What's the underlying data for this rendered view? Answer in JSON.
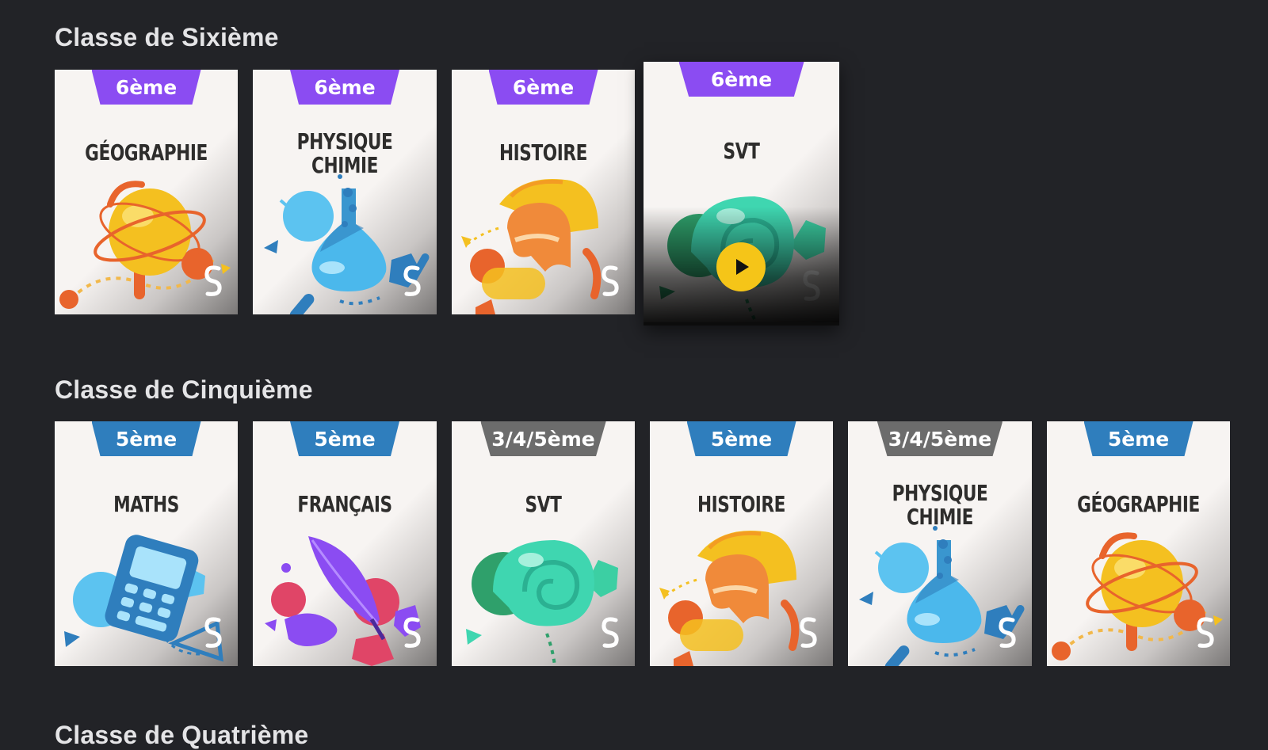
{
  "sections": [
    {
      "title": "Classe de Sixième",
      "cards": [
        {
          "badge": "6ème",
          "badge_color": "#8b4cf2",
          "title": "GÉOGRAPHIE",
          "illustration": "globe-icon"
        },
        {
          "badge": "6ème",
          "badge_color": "#8b4cf2",
          "title": "PHYSIQUE\nCHIMIE",
          "illustration": "flask-icon"
        },
        {
          "badge": "6ème",
          "badge_color": "#8b4cf2",
          "title": "HISTOIRE",
          "illustration": "helmet-icon"
        },
        {
          "badge": "6ème",
          "badge_color": "#8b4cf2",
          "title": "SVT",
          "illustration": "shell-icon",
          "state": "hover-with-play"
        }
      ]
    },
    {
      "title": "Classe de Cinquième",
      "cards": [
        {
          "badge": "5ème",
          "badge_color": "#2f7ebd",
          "title": "MATHS",
          "illustration": "calculator-icon"
        },
        {
          "badge": "5ème",
          "badge_color": "#2f7ebd",
          "title": "FRANÇAIS",
          "illustration": "feather-icon"
        },
        {
          "badge": "3/4/5ème",
          "badge_color": "#6c6c6c",
          "title": "SVT",
          "illustration": "shell-icon"
        },
        {
          "badge": "5ème",
          "badge_color": "#2f7ebd",
          "title": "HISTOIRE",
          "illustration": "helmet-icon"
        },
        {
          "badge": "3/4/5ème",
          "badge_color": "#6c6c6c",
          "title": "PHYSIQUE\nCHIMIE",
          "illustration": "flask-icon"
        },
        {
          "badge": "5ème",
          "badge_color": "#2f7ebd",
          "title": "GÉOGRAPHIE",
          "illustration": "globe-icon"
        }
      ]
    },
    {
      "title": "Classe de Quatrième",
      "cards": []
    }
  ],
  "colors": {
    "background": "#222327",
    "card": "#f7f4f2",
    "play_button": "#f5c518"
  },
  "logo_icon": "schoolmouv-s-logo-icon",
  "play_icon": "play-icon"
}
